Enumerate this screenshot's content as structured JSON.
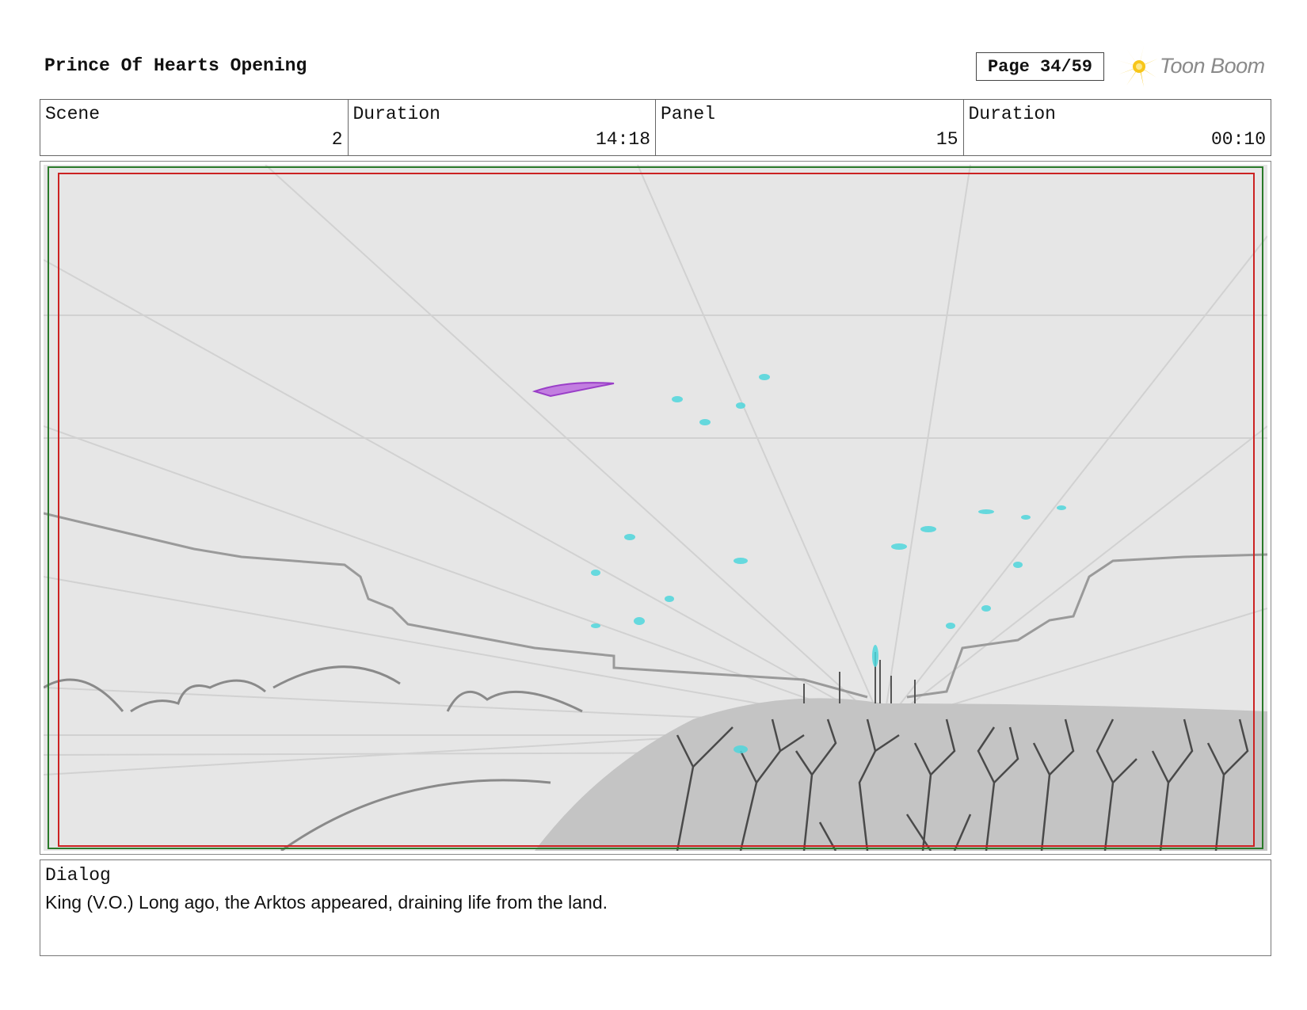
{
  "header": {
    "title": "Prince Of Hearts Opening",
    "page": "Page 34/59",
    "logo_text": "Toon Boom",
    "logo_icon": "starburst-icon"
  },
  "info": {
    "scene_label": "Scene",
    "scene_value": "2",
    "scene_duration_label": "Duration",
    "scene_duration_value": "14:18",
    "panel_label": "Panel",
    "panel_value": "15",
    "panel_duration_label": "Duration",
    "panel_duration_value": "00:10"
  },
  "dialog": {
    "label": "Dialog",
    "text": "King (V.O.) Long ago, the Arktos appeared, draining life from the land."
  },
  "colors": {
    "safe_frame": "#cc2222",
    "camera_frame": "#2a7a2a",
    "sketch_accent": "#4fd6dc",
    "character": "#b057d8",
    "logo_yellow": "#f7c61a"
  }
}
